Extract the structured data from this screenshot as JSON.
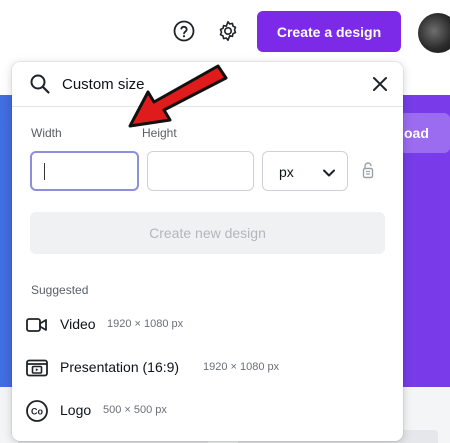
{
  "header": {
    "create_label": "Create a design"
  },
  "background": {
    "upload_label": "oad"
  },
  "popover": {
    "search": {
      "value": "Custom size",
      "placeholder": ""
    },
    "width_label": "Width",
    "height_label": "Height",
    "width_value": "",
    "height_value": "",
    "unit_value": "px",
    "create_button_label": "Create new design",
    "suggested_title": "Suggested",
    "suggestions": [
      {
        "name": "Video",
        "dimensions": "1920 × 1080 px",
        "icon": "video-icon"
      },
      {
        "name": "Presentation (16:9)",
        "dimensions": "1920 × 1080 px",
        "icon": "presentation-icon"
      },
      {
        "name": "Logo",
        "dimensions": "500 × 500 px",
        "icon": "logo-icon"
      }
    ]
  },
  "colors": {
    "accent": "#7d2ae8",
    "annotation": "#e01b1b"
  }
}
